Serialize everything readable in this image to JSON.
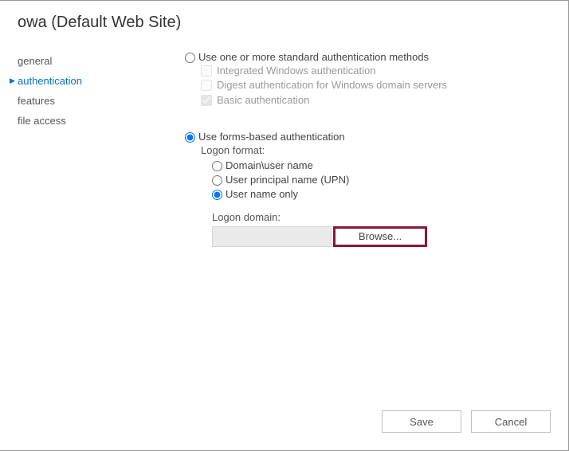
{
  "title": "owa (Default Web Site)",
  "sidebar": {
    "items": [
      {
        "label": "general",
        "active": false
      },
      {
        "label": "authentication",
        "active": true
      },
      {
        "label": "features",
        "active": false
      },
      {
        "label": "file access",
        "active": false
      }
    ]
  },
  "auth": {
    "standard": {
      "radio_label": "Use one or more standard authentication methods",
      "selected": false,
      "options": [
        {
          "label": "Integrated Windows authentication",
          "checked": false,
          "disabled": true
        },
        {
          "label": "Digest authentication for Windows domain servers",
          "checked": false,
          "disabled": true
        },
        {
          "label": "Basic authentication",
          "checked": true,
          "disabled": true
        }
      ]
    },
    "forms": {
      "radio_label": "Use forms-based authentication",
      "selected": true,
      "logon_format_label": "Logon format:",
      "options": [
        {
          "label": "Domain\\user name",
          "selected": false
        },
        {
          "label": "User principal name (UPN)",
          "selected": false
        },
        {
          "label": "User name only",
          "selected": true
        }
      ],
      "logon_domain_label": "Logon domain:",
      "logon_domain_value": "",
      "browse_label": "Browse..."
    }
  },
  "footer": {
    "save": "Save",
    "cancel": "Cancel"
  }
}
